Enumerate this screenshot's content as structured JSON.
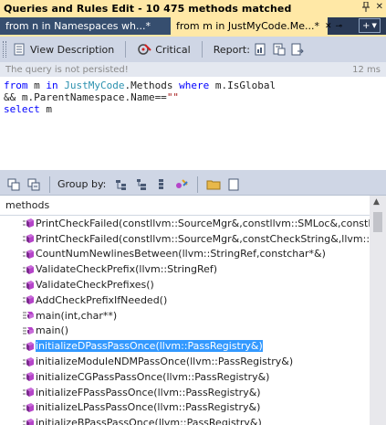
{
  "window": {
    "title": "Queries and Rules Edit  - 10 475 methods matched",
    "pin_icon": "pin-icon",
    "close_label": "✕"
  },
  "tabs": [
    {
      "label": "from n in Namespaces wh...*"
    },
    {
      "label": "from m in JustMyCode.Me...*"
    }
  ],
  "toolbar": {
    "view_description_label": "View Description",
    "critical_label": "Critical",
    "report_label": "Report:"
  },
  "status": {
    "message": "The query is not persisted!",
    "duration": "12 ms"
  },
  "editor": {
    "lines": [
      "from m in JustMyCode.Methods where m.IsGlobal",
      "&& m.ParentNamespace.Name==\"\"",
      "select m"
    ]
  },
  "results_toolbar": {
    "group_by_label": "Group by:"
  },
  "results": {
    "column_header": "methods",
    "rows": [
      {
        "label": "PrintCheckFailed(constllvm::SourceMgr&,constllvm::SMLoc&,constPatte",
        "icon": "method-icon",
        "selected": false
      },
      {
        "label": "PrintCheckFailed(constllvm::SourceMgr&,constCheckString&,llvm::Strin",
        "icon": "method-icon",
        "selected": false
      },
      {
        "label": "CountNumNewlinesBetween(llvm::StringRef,constchar*&)",
        "icon": "method-icon",
        "selected": false
      },
      {
        "label": "ValidateCheckPrefix(llvm::StringRef)",
        "icon": "method-icon",
        "selected": false
      },
      {
        "label": "ValidateCheckPrefixes()",
        "icon": "method-icon",
        "selected": false
      },
      {
        "label": "AddCheckPrefixIfNeeded()",
        "icon": "method-icon",
        "selected": false
      },
      {
        "label": "main(int,char**)",
        "icon": "main-method-icon",
        "selected": false
      },
      {
        "label": "main()",
        "icon": "main-method-icon",
        "selected": false
      },
      {
        "label": "initializeDPassPassOnce(llvm::PassRegistry&)",
        "icon": "method-icon",
        "selected": true
      },
      {
        "label": "initializeModuleNDMPassOnce(llvm::PassRegistry&)",
        "icon": "method-icon",
        "selected": false
      },
      {
        "label": "initializeCGPassPassOnce(llvm::PassRegistry&)",
        "icon": "method-icon",
        "selected": false
      },
      {
        "label": "initializeFPassPassOnce(llvm::PassRegistry&)",
        "icon": "method-icon",
        "selected": false
      },
      {
        "label": "initializeLPassPassOnce(llvm::PassRegistry&)",
        "icon": "method-icon",
        "selected": false
      },
      {
        "label": "initializeBPassPassOnce(llvm::PassRegistry&)",
        "icon": "method-icon",
        "selected": false
      }
    ]
  },
  "colors": {
    "title_bg": "#ffe8a6",
    "panel_bg": "#293955",
    "toolbar_bg": "#cfd6e5",
    "selection": "#3399ff",
    "keyword": "#0000ff",
    "type": "#2b91af",
    "string": "#a31515",
    "method_icon": "#b544c9"
  }
}
